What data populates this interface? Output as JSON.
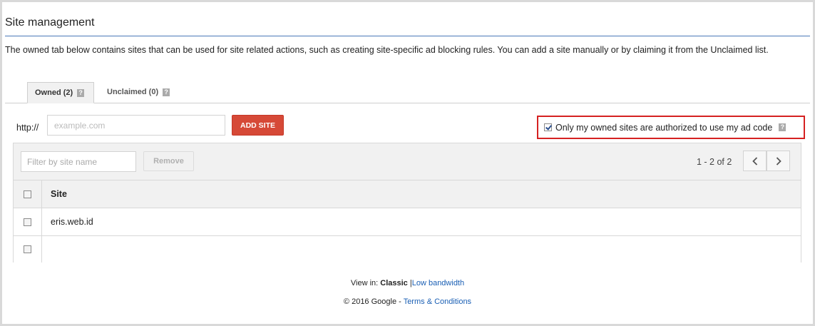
{
  "page": {
    "title": "Site management",
    "description": "The owned tab below contains sites that can be used for site related actions, such as creating site-specific ad blocking rules. You can add a site manually or by claiming it from the Unclaimed list."
  },
  "tabs": [
    {
      "label": "Owned (2)",
      "active": true
    },
    {
      "label": "Unclaimed (0)",
      "active": false
    }
  ],
  "add_site": {
    "prefix": "http://",
    "placeholder": "example.com",
    "value": "",
    "button_label": "ADD SITE"
  },
  "authorization": {
    "label": "Only my owned sites are authorized to use my ad code",
    "checked": true
  },
  "table": {
    "filter_placeholder": "Filter by site name",
    "remove_label": "Remove",
    "paging": "1 - 2 of 2",
    "column_site": "Site",
    "rows": [
      {
        "site": "eris.web.id"
      },
      {
        "site": ""
      }
    ]
  },
  "footer": {
    "view_in": "View in:",
    "classic": "Classic",
    "separator": "|",
    "low_bandwidth": "Low bandwidth",
    "copyright": "© 2016 Google",
    "dash": "-",
    "terms": "Terms & Conditions"
  },
  "colors": {
    "accent_rule": "#4a78b8",
    "add_button": "#d64937",
    "highlight_box": "#d52121",
    "link": "#1a5fb4"
  },
  "icons": {
    "help": "help-icon",
    "prev": "chevron-left-icon",
    "next": "chevron-right-icon"
  }
}
